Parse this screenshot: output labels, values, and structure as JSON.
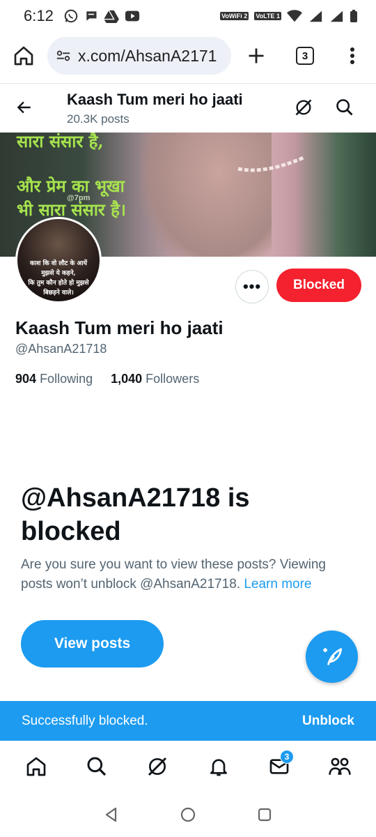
{
  "status_bar": {
    "time": "6:12",
    "chip_wifi": "VoWiFi 2",
    "chip_lte": "VoLTE 1",
    "icons": [
      "whatsapp-icon",
      "chat-icon",
      "drive-icon",
      "youtube-icon",
      "wifi-icon",
      "signal-icon",
      "battery-icon"
    ]
  },
  "browser": {
    "url": "x.com/AhsanA2171",
    "tab_count": "3"
  },
  "profile_header": {
    "name": "Kaash Tum meri ho jaati",
    "posts": "20.3K posts"
  },
  "banner": {
    "line1": "सारा संसार है,",
    "line2": "और प्रेम का भूखा",
    "line3": "भी सारा संसार है।",
    "watermark": "@7pm"
  },
  "avatar": {
    "line1": "काश कि वो लौट के आयें",
    "line2": "मुझसे ये कहने,",
    "line3": "कि तुम कौन होते हो मुझसे",
    "line4": "बिछड़ने वाले।"
  },
  "profile": {
    "name": "Kaash Tum meri ho jaati",
    "handle": "@AhsanA21718",
    "following_count": "904",
    "following_label": "Following",
    "followers_count": "1,040",
    "followers_label": "Followers",
    "more_label": "•••",
    "blocked_button": "Blocked"
  },
  "blocked_notice": {
    "title": "@AhsanA21718 is blocked",
    "description": "Are you sure you want to view these posts? Viewing posts won’t unblock @AhsanA21718.",
    "learn_more": "Learn more",
    "view_posts_button": "View posts"
  },
  "toast": {
    "message": "Successfully blocked.",
    "action": "Unblock"
  },
  "bottom_nav": {
    "messages_badge": "3"
  },
  "colors": {
    "accent": "#1d9bf0",
    "blocked_red": "#f4212e",
    "secondary_text": "#536471"
  }
}
